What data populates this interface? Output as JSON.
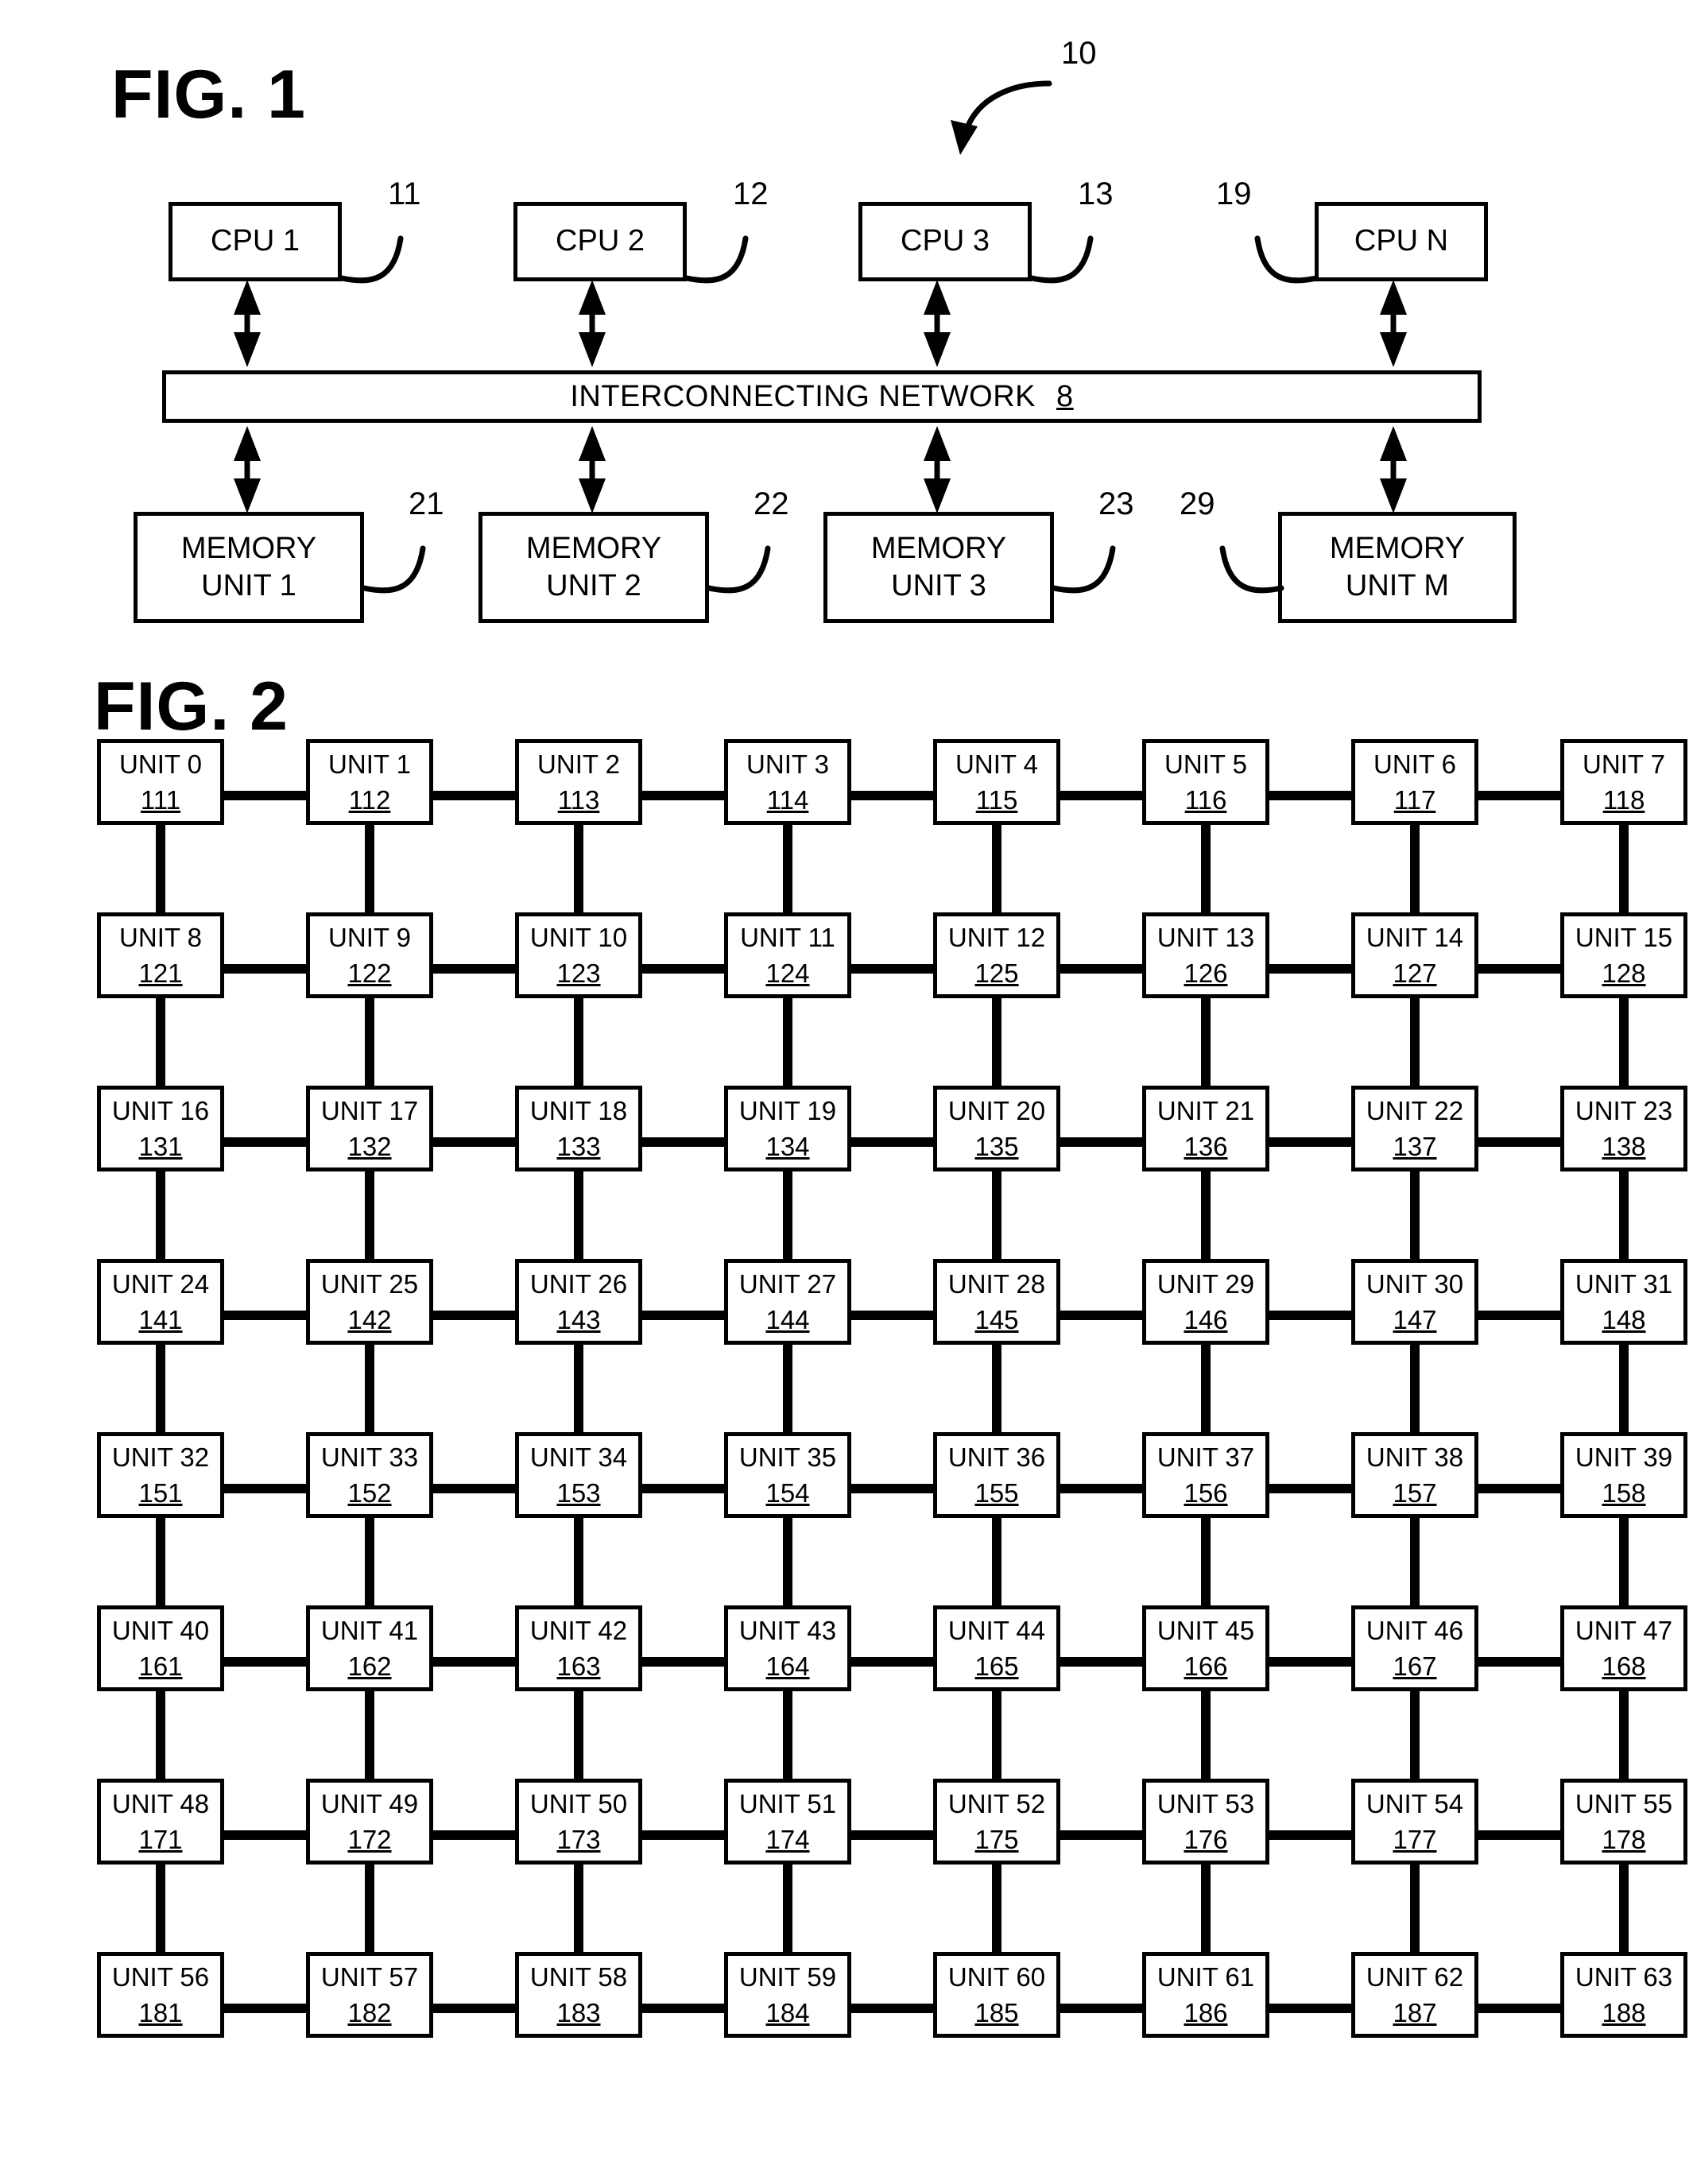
{
  "figures": {
    "fig1": {
      "title": "FIG. 1",
      "system_ref": "10",
      "cpus": [
        {
          "label": "CPU 1",
          "ref": "11",
          "ref_side": "right"
        },
        {
          "label": "CPU 2",
          "ref": "12",
          "ref_side": "right"
        },
        {
          "label": "CPU 3",
          "ref": "13",
          "ref_side": "right"
        },
        {
          "label": "CPU N",
          "ref": "19",
          "ref_side": "left"
        }
      ],
      "network": {
        "label": "INTERCONNECTING NETWORK",
        "ref": "8"
      },
      "memories": [
        {
          "line1": "MEMORY",
          "line2": "UNIT 1",
          "ref": "21",
          "ref_side": "right"
        },
        {
          "line1": "MEMORY",
          "line2": "UNIT 2",
          "ref": "22",
          "ref_side": "right"
        },
        {
          "line1": "MEMORY",
          "line2": "UNIT 3",
          "ref": "23",
          "ref_side": "right"
        },
        {
          "line1": "MEMORY",
          "line2": "UNIT M",
          "ref": "29",
          "ref_side": "left"
        }
      ]
    },
    "fig2": {
      "title": "FIG. 2",
      "columns": 8,
      "rows": 8,
      "cells": [
        [
          {
            "label": "UNIT 0",
            "ref": "111"
          },
          {
            "label": "UNIT 1",
            "ref": "112"
          },
          {
            "label": "UNIT 2",
            "ref": "113"
          },
          {
            "label": "UNIT 3",
            "ref": "114"
          },
          {
            "label": "UNIT 4",
            "ref": "115"
          },
          {
            "label": "UNIT 5",
            "ref": "116"
          },
          {
            "label": "UNIT 6",
            "ref": "117"
          },
          {
            "label": "UNIT 7",
            "ref": "118"
          }
        ],
        [
          {
            "label": "UNIT 8",
            "ref": "121"
          },
          {
            "label": "UNIT 9",
            "ref": "122"
          },
          {
            "label": "UNIT 10",
            "ref": "123"
          },
          {
            "label": "UNIT 11",
            "ref": "124"
          },
          {
            "label": "UNIT 12",
            "ref": "125"
          },
          {
            "label": "UNIT 13",
            "ref": "126"
          },
          {
            "label": "UNIT 14",
            "ref": "127"
          },
          {
            "label": "UNIT 15",
            "ref": "128"
          }
        ],
        [
          {
            "label": "UNIT 16",
            "ref": "131"
          },
          {
            "label": "UNIT 17",
            "ref": "132"
          },
          {
            "label": "UNIT 18",
            "ref": "133"
          },
          {
            "label": "UNIT 19",
            "ref": "134"
          },
          {
            "label": "UNIT 20",
            "ref": "135"
          },
          {
            "label": "UNIT 21",
            "ref": "136"
          },
          {
            "label": "UNIT 22",
            "ref": "137"
          },
          {
            "label": "UNIT 23",
            "ref": "138"
          }
        ],
        [
          {
            "label": "UNIT 24",
            "ref": "141"
          },
          {
            "label": "UNIT 25",
            "ref": "142"
          },
          {
            "label": "UNIT 26",
            "ref": "143"
          },
          {
            "label": "UNIT 27",
            "ref": "144"
          },
          {
            "label": "UNIT 28",
            "ref": "145"
          },
          {
            "label": "UNIT 29",
            "ref": "146"
          },
          {
            "label": "UNIT 30",
            "ref": "147"
          },
          {
            "label": "UNIT 31",
            "ref": "148"
          }
        ],
        [
          {
            "label": "UNIT 32",
            "ref": "151"
          },
          {
            "label": "UNIT 33",
            "ref": "152"
          },
          {
            "label": "UNIT 34",
            "ref": "153"
          },
          {
            "label": "UNIT 35",
            "ref": "154"
          },
          {
            "label": "UNIT 36",
            "ref": "155"
          },
          {
            "label": "UNIT 37",
            "ref": "156"
          },
          {
            "label": "UNIT 38",
            "ref": "157"
          },
          {
            "label": "UNIT 39",
            "ref": "158"
          }
        ],
        [
          {
            "label": "UNIT 40",
            "ref": "161"
          },
          {
            "label": "UNIT 41",
            "ref": "162"
          },
          {
            "label": "UNIT 42",
            "ref": "163"
          },
          {
            "label": "UNIT 43",
            "ref": "164"
          },
          {
            "label": "UNIT 44",
            "ref": "165"
          },
          {
            "label": "UNIT 45",
            "ref": "166"
          },
          {
            "label": "UNIT 46",
            "ref": "167"
          },
          {
            "label": "UNIT 47",
            "ref": "168"
          }
        ],
        [
          {
            "label": "UNIT 48",
            "ref": "171"
          },
          {
            "label": "UNIT 49",
            "ref": "172"
          },
          {
            "label": "UNIT 50",
            "ref": "173"
          },
          {
            "label": "UNIT 51",
            "ref": "174"
          },
          {
            "label": "UNIT 52",
            "ref": "175"
          },
          {
            "label": "UNIT 53",
            "ref": "176"
          },
          {
            "label": "UNIT 54",
            "ref": "177"
          },
          {
            "label": "UNIT 55",
            "ref": "178"
          }
        ],
        [
          {
            "label": "UNIT 56",
            "ref": "181"
          },
          {
            "label": "UNIT 57",
            "ref": "182"
          },
          {
            "label": "UNIT 58",
            "ref": "183"
          },
          {
            "label": "UNIT 59",
            "ref": "184"
          },
          {
            "label": "UNIT 60",
            "ref": "185"
          },
          {
            "label": "UNIT 61",
            "ref": "186"
          },
          {
            "label": "UNIT 62",
            "ref": "187"
          },
          {
            "label": "UNIT 63",
            "ref": "188"
          }
        ]
      ]
    }
  }
}
